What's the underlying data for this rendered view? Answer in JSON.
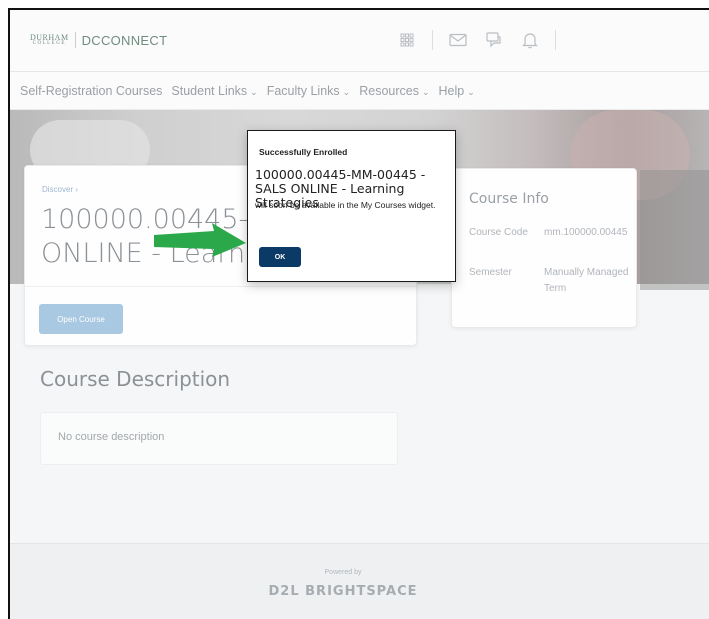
{
  "header": {
    "logo_top": "DURHAM",
    "logo_bottom": "COLLEGE",
    "logo_product": "DCCONNECT",
    "icons": [
      "grid-icon",
      "mail-icon",
      "chat-icon",
      "bell-icon"
    ]
  },
  "nav": {
    "items": [
      {
        "label": "Self-Registration Courses",
        "has_menu": false
      },
      {
        "label": "Student Links",
        "has_menu": true
      },
      {
        "label": "Faculty Links",
        "has_menu": true
      },
      {
        "label": "Resources",
        "has_menu": true
      },
      {
        "label": "Help",
        "has_menu": true
      }
    ],
    "chevron": "⌄"
  },
  "course": {
    "breadcrumb": "Discover ›",
    "title_line1": "100000.00445-MM",
    "title_line2": "ONLINE - Learning",
    "open_button": "Open Course"
  },
  "info": {
    "title": "Course Info",
    "code_label": "Course Code",
    "code_value": "mm.100000.00445",
    "semester_label": "Semester",
    "semester_value": "Manually Managed Term"
  },
  "description": {
    "heading": "Course Description",
    "text": "No course description"
  },
  "footer": {
    "powered": "Powered by",
    "brand": "D2L BRIGHTSPACE"
  },
  "dialog": {
    "title": "Successfully Enrolled",
    "course_name": "100000.00445-MM-00445 - SALS ONLINE - Learning Strategies",
    "message": "will soon be available in the My Courses widget.",
    "ok": "OK"
  },
  "colors": {
    "annotation_arrow": "#2aa84a",
    "ok_button": "#0b3a66",
    "open_button": "#a9c8e2"
  }
}
